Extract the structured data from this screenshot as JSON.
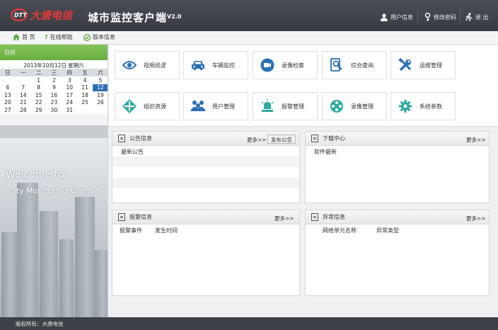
{
  "header": {
    "app_title": "城市监控客户端",
    "version": "V2.0",
    "logo_text": "大唐电信",
    "user_info": "用户信息",
    "change_password": "修改密码",
    "logout": "退 出"
  },
  "subnav": {
    "home": "首 页",
    "online_help": "在线帮助",
    "version_info": "版本信息"
  },
  "calendar": {
    "title": "日历",
    "date_label": "2013年10月12日 星期六",
    "weekdays": [
      "日",
      "一",
      "二",
      "三",
      "四",
      "五",
      "六"
    ],
    "weeks": [
      [
        "",
        "",
        "1",
        "2",
        "3",
        "4",
        "5"
      ],
      [
        "6",
        "7",
        "8",
        "9",
        "10",
        "11",
        "12"
      ],
      [
        "13",
        "14",
        "15",
        "16",
        "17",
        "18",
        "19"
      ],
      [
        "20",
        "21",
        "22",
        "23",
        "24",
        "25",
        "26"
      ],
      [
        "27",
        "28",
        "29",
        "30",
        "31",
        "",
        ""
      ]
    ],
    "selected": "12"
  },
  "welcome": {
    "line1": "Welcome to",
    "line2": "City Monitoring Client !"
  },
  "tiles": [
    {
      "label": "视频巡逻",
      "icon": "eye-icon"
    },
    {
      "label": "车辆监控",
      "icon": "car-icon"
    },
    {
      "label": "录像检索",
      "icon": "camera-icon"
    },
    {
      "label": "综合查询",
      "icon": "search-document-icon"
    },
    {
      "label": "运维管理",
      "icon": "tools-icon"
    },
    {
      "label": "组织资源",
      "icon": "network-icon"
    },
    {
      "label": "用户管理",
      "icon": "users-icon"
    },
    {
      "label": "报警管理",
      "icon": "alarm-icon"
    },
    {
      "label": "录像管理",
      "icon": "film-icon"
    },
    {
      "label": "系统参数",
      "icon": "gear-icon"
    }
  ],
  "panels": {
    "notice": {
      "title": "公告信息",
      "more": "更多>>",
      "publish": "发布公告",
      "row1": "最新公告"
    },
    "download": {
      "title": "下载中心",
      "more": "更多>>",
      "row1": "软件最新"
    },
    "alarm": {
      "title": "报警信息",
      "more": "更多>>",
      "col1": "报警事件",
      "col2": "发生时间"
    },
    "exception": {
      "title": "异常信息",
      "more": "更多>>",
      "col1": "网络单元名称",
      "col2": "异常类型"
    }
  },
  "footer": {
    "copyright": "版权所有：大唐电信"
  },
  "colors": {
    "header_bg": "#3f424a",
    "calendar_green": "#72b349",
    "tile_blue": "#2a6fb5",
    "selected_day": "#2a6fb5"
  }
}
